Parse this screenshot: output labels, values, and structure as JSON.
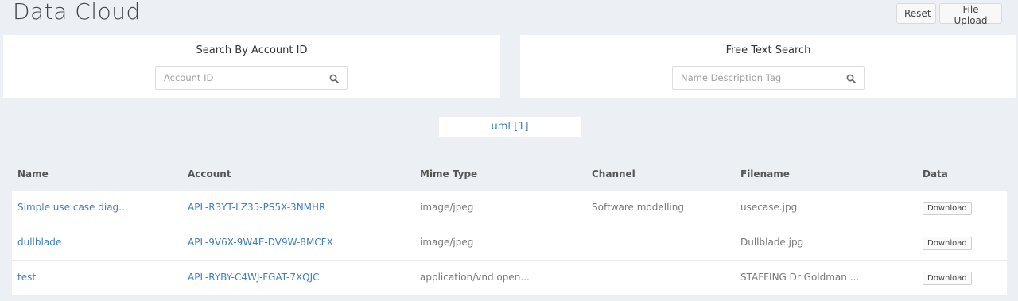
{
  "header": {
    "title": "Data Cloud",
    "reset_label": "Reset",
    "upload_label": "File Upload"
  },
  "search_account": {
    "title": "Search By Account ID",
    "placeholder": "Account ID",
    "value": ""
  },
  "search_text": {
    "title": "Free Text Search",
    "placeholder": "Name Description Tag",
    "value": ""
  },
  "tag": {
    "label": "uml [1]"
  },
  "table": {
    "headers": [
      "Name",
      "Account",
      "Mime Type",
      "Channel",
      "Filename",
      "Data"
    ],
    "rows": [
      {
        "name": "Simple use case diag...",
        "account": "APL-R3YT-LZ35-PS5X-3NMHR",
        "mime": "image/jpeg",
        "channel": "Software modelling",
        "filename": "usecase.jpg",
        "data": "Download"
      },
      {
        "name": "dullblade",
        "account": "APL-9V6X-9W4E-DV9W-8MCFX",
        "mime": "image/jpeg",
        "channel": "",
        "filename": "Dullblade.jpg",
        "data": "Download"
      },
      {
        "name": "test",
        "account": "APL-RYBY-C4WJ-FGAT-7XQJC",
        "mime": "application/vnd.open...",
        "channel": "",
        "filename": "STAFFING Dr Goldman ...",
        "data": "Download"
      }
    ]
  },
  "icons": {
    "search": "search-icon"
  },
  "colors": {
    "link": "#3b7fc4",
    "background": "#ecf0f4"
  }
}
